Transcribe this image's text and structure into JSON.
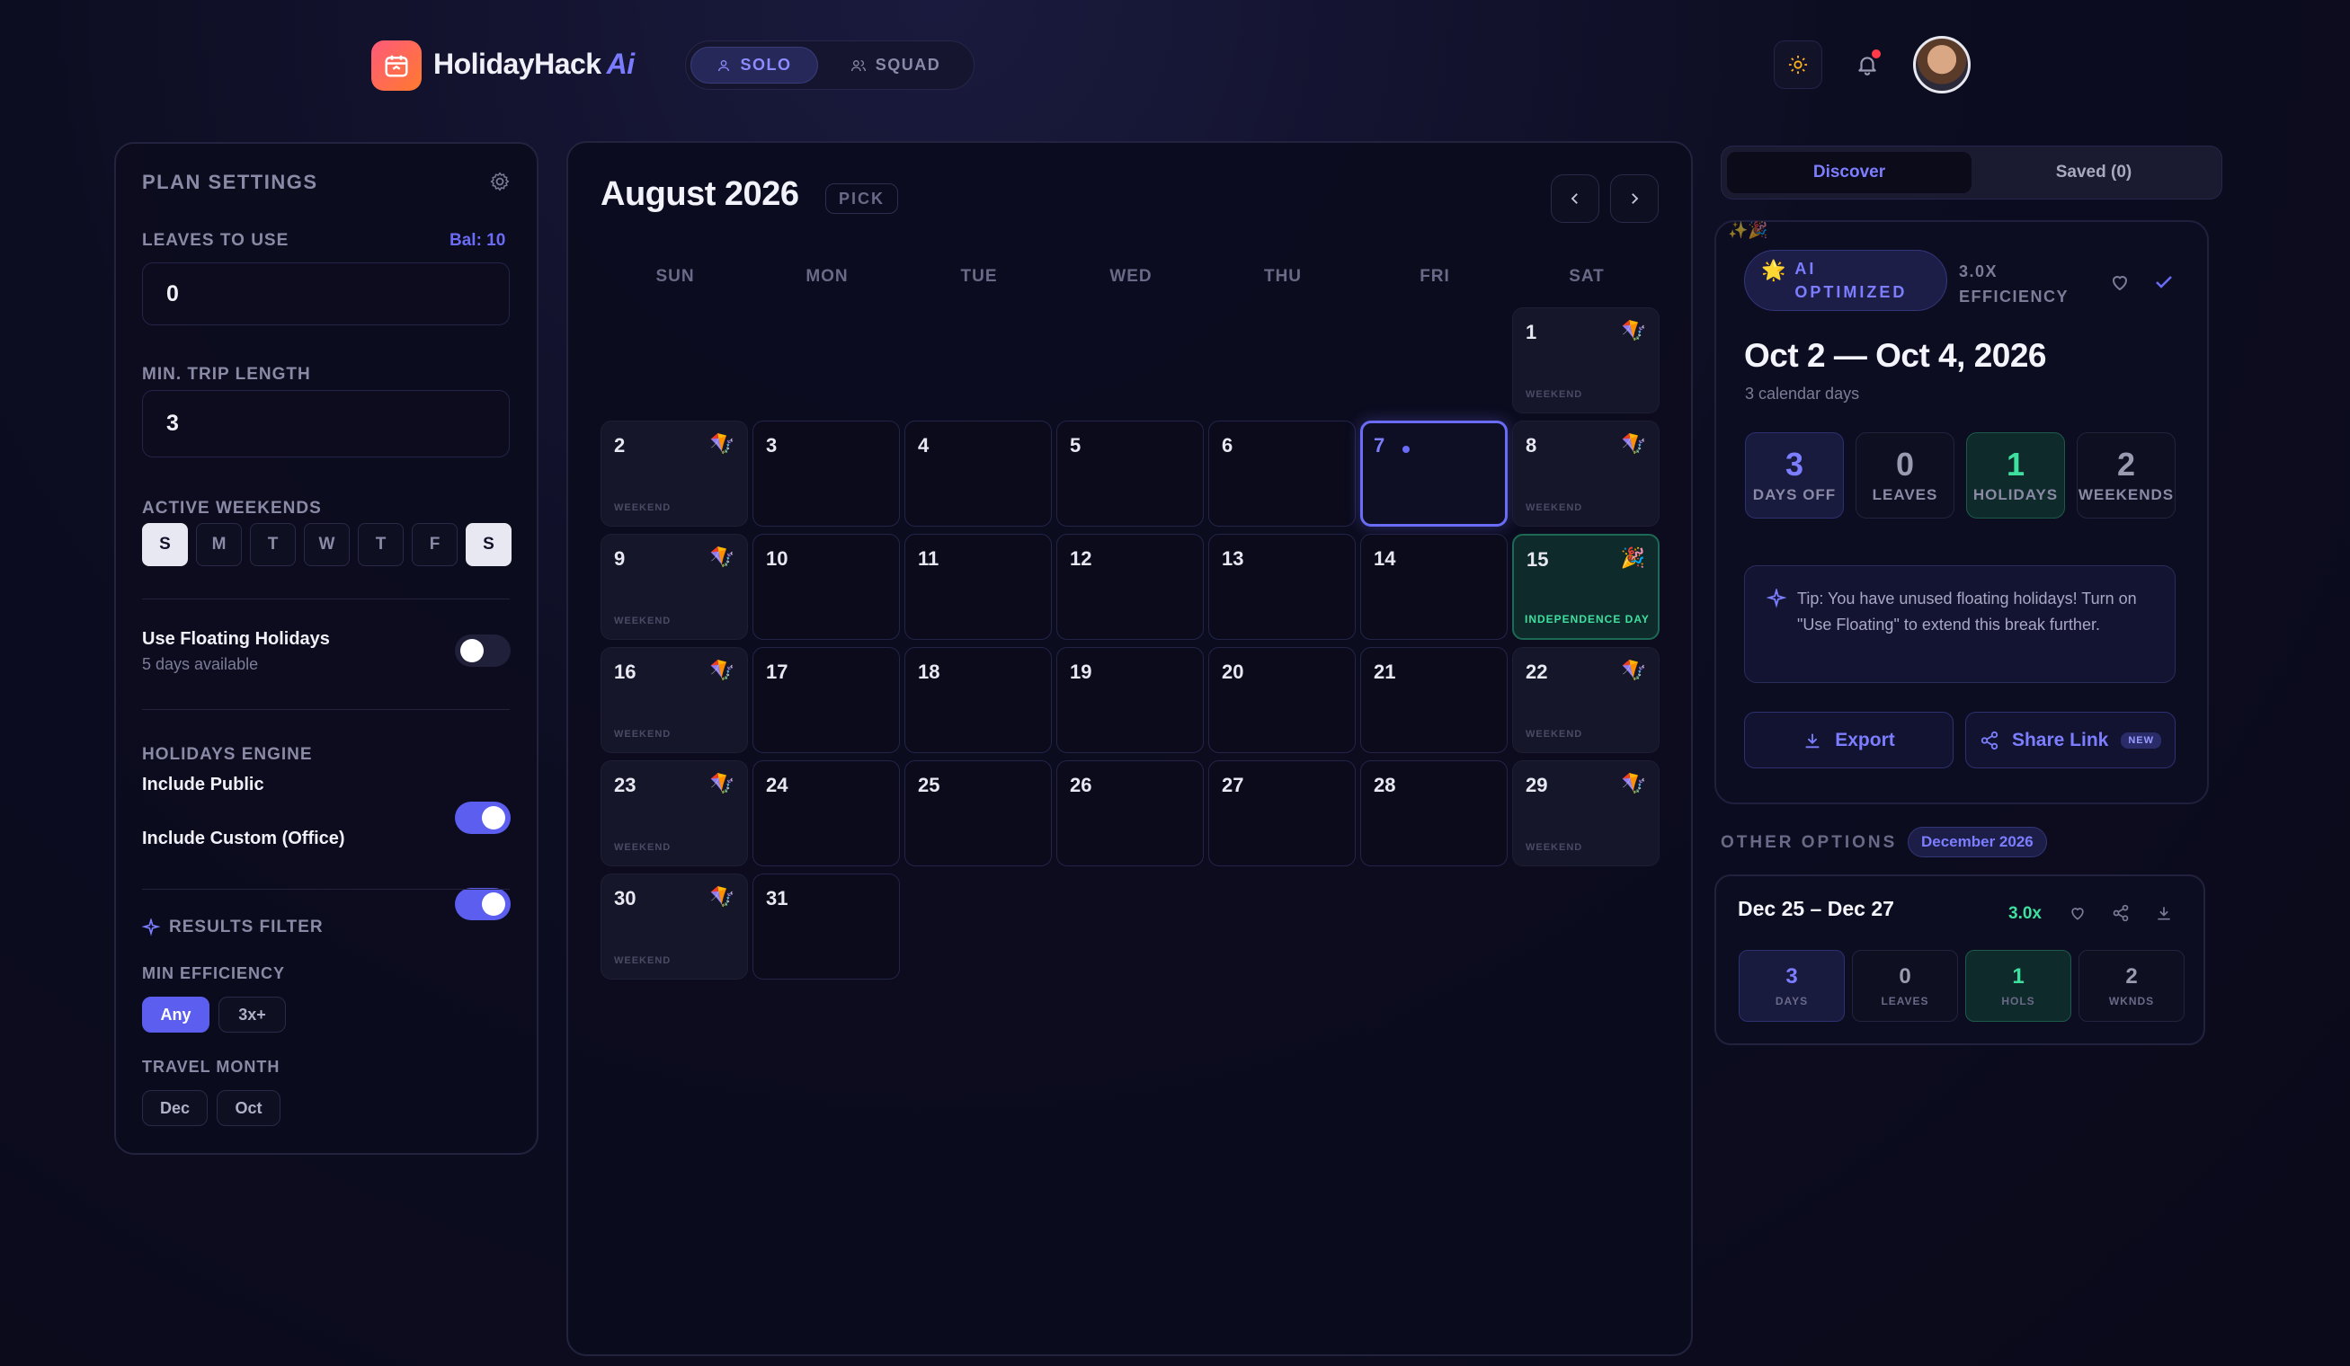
{
  "header": {
    "brand": "HolidayHack",
    "brand_ai": "Ai",
    "modes": [
      {
        "label": "SOLO",
        "active": true
      },
      {
        "label": "SQUAD",
        "active": false
      }
    ]
  },
  "settings": {
    "title": "PLAN SETTINGS",
    "leaves_label": "LEAVES TO USE",
    "balance": "Bal: 10",
    "leaves_value": "0",
    "min_trip_label": "MIN. TRIP LENGTH",
    "min_trip_value": "3",
    "weekends_label": "ACTIVE WEEKENDS",
    "weekdays": [
      {
        "label": "S",
        "on": true
      },
      {
        "label": "M",
        "on": false
      },
      {
        "label": "T",
        "on": false
      },
      {
        "label": "W",
        "on": false
      },
      {
        "label": "T",
        "on": false
      },
      {
        "label": "F",
        "on": false
      },
      {
        "label": "S",
        "on": true
      }
    ],
    "floating_title": "Use Floating Holidays",
    "floating_sub": "5 days available",
    "engine_label": "HOLIDAYS ENGINE",
    "include_public": "Include Public",
    "include_custom": "Include Custom (Office)",
    "results_filter": "RESULTS FILTER",
    "min_eff_label": "MIN EFFICIENCY",
    "eff_options": [
      "Any",
      "3x+"
    ],
    "travel_month_label": "TRAVEL MONTH",
    "months": [
      "Dec",
      "Oct"
    ]
  },
  "calendar": {
    "title": "August 2026",
    "pick": "PICK",
    "dows": [
      "SUN",
      "MON",
      "TUE",
      "WED",
      "THU",
      "FRI",
      "SAT"
    ],
    "weekend_tag": "WEEKEND",
    "holiday_tag": "INDEPENDENCE DAY",
    "days": [
      "1",
      "2",
      "3",
      "4",
      "5",
      "6",
      "7",
      "8",
      "9",
      "10",
      "11",
      "12",
      "13",
      "14",
      "15",
      "16",
      "17",
      "18",
      "19",
      "20",
      "21",
      "22",
      "23",
      "24",
      "25",
      "26",
      "27",
      "28",
      "29",
      "30",
      "31"
    ]
  },
  "right": {
    "tabs": [
      "Discover",
      "Saved (0)"
    ],
    "ai_badge": [
      "AI",
      "OPTIMIZED"
    ],
    "efficiency": [
      "3.0X",
      "EFFICIENCY"
    ],
    "date_range": "Oct 2 — Oct 4, 2026",
    "calendar_days": "3 calendar days",
    "stats": [
      {
        "value": "3",
        "label": "DAYS OFF"
      },
      {
        "value": "0",
        "label": "LEAVES"
      },
      {
        "value": "1",
        "label": "HOLIDAYS"
      },
      {
        "value": "2",
        "label": "WEEKENDS"
      }
    ],
    "tip": "Tip: You have unused floating holidays! Turn on \"Use Floating\" to extend this break further.",
    "export": "Export",
    "share": "Share Link",
    "new": "NEW",
    "other_title": "OTHER OPTIONS",
    "other_month": "December 2026",
    "option": {
      "range": "Dec 25 – Dec 27",
      "eff": "3.0x",
      "stats": [
        {
          "value": "3",
          "label": "DAYS"
        },
        {
          "value": "0",
          "label": "LEAVES"
        },
        {
          "value": "1",
          "label": "HOLS"
        },
        {
          "value": "2",
          "label": "WKNDS"
        }
      ]
    }
  },
  "colors": {
    "accent": "#6a6cf6",
    "holiday": "#3ee0a0",
    "logo": "#ff6a4a"
  }
}
